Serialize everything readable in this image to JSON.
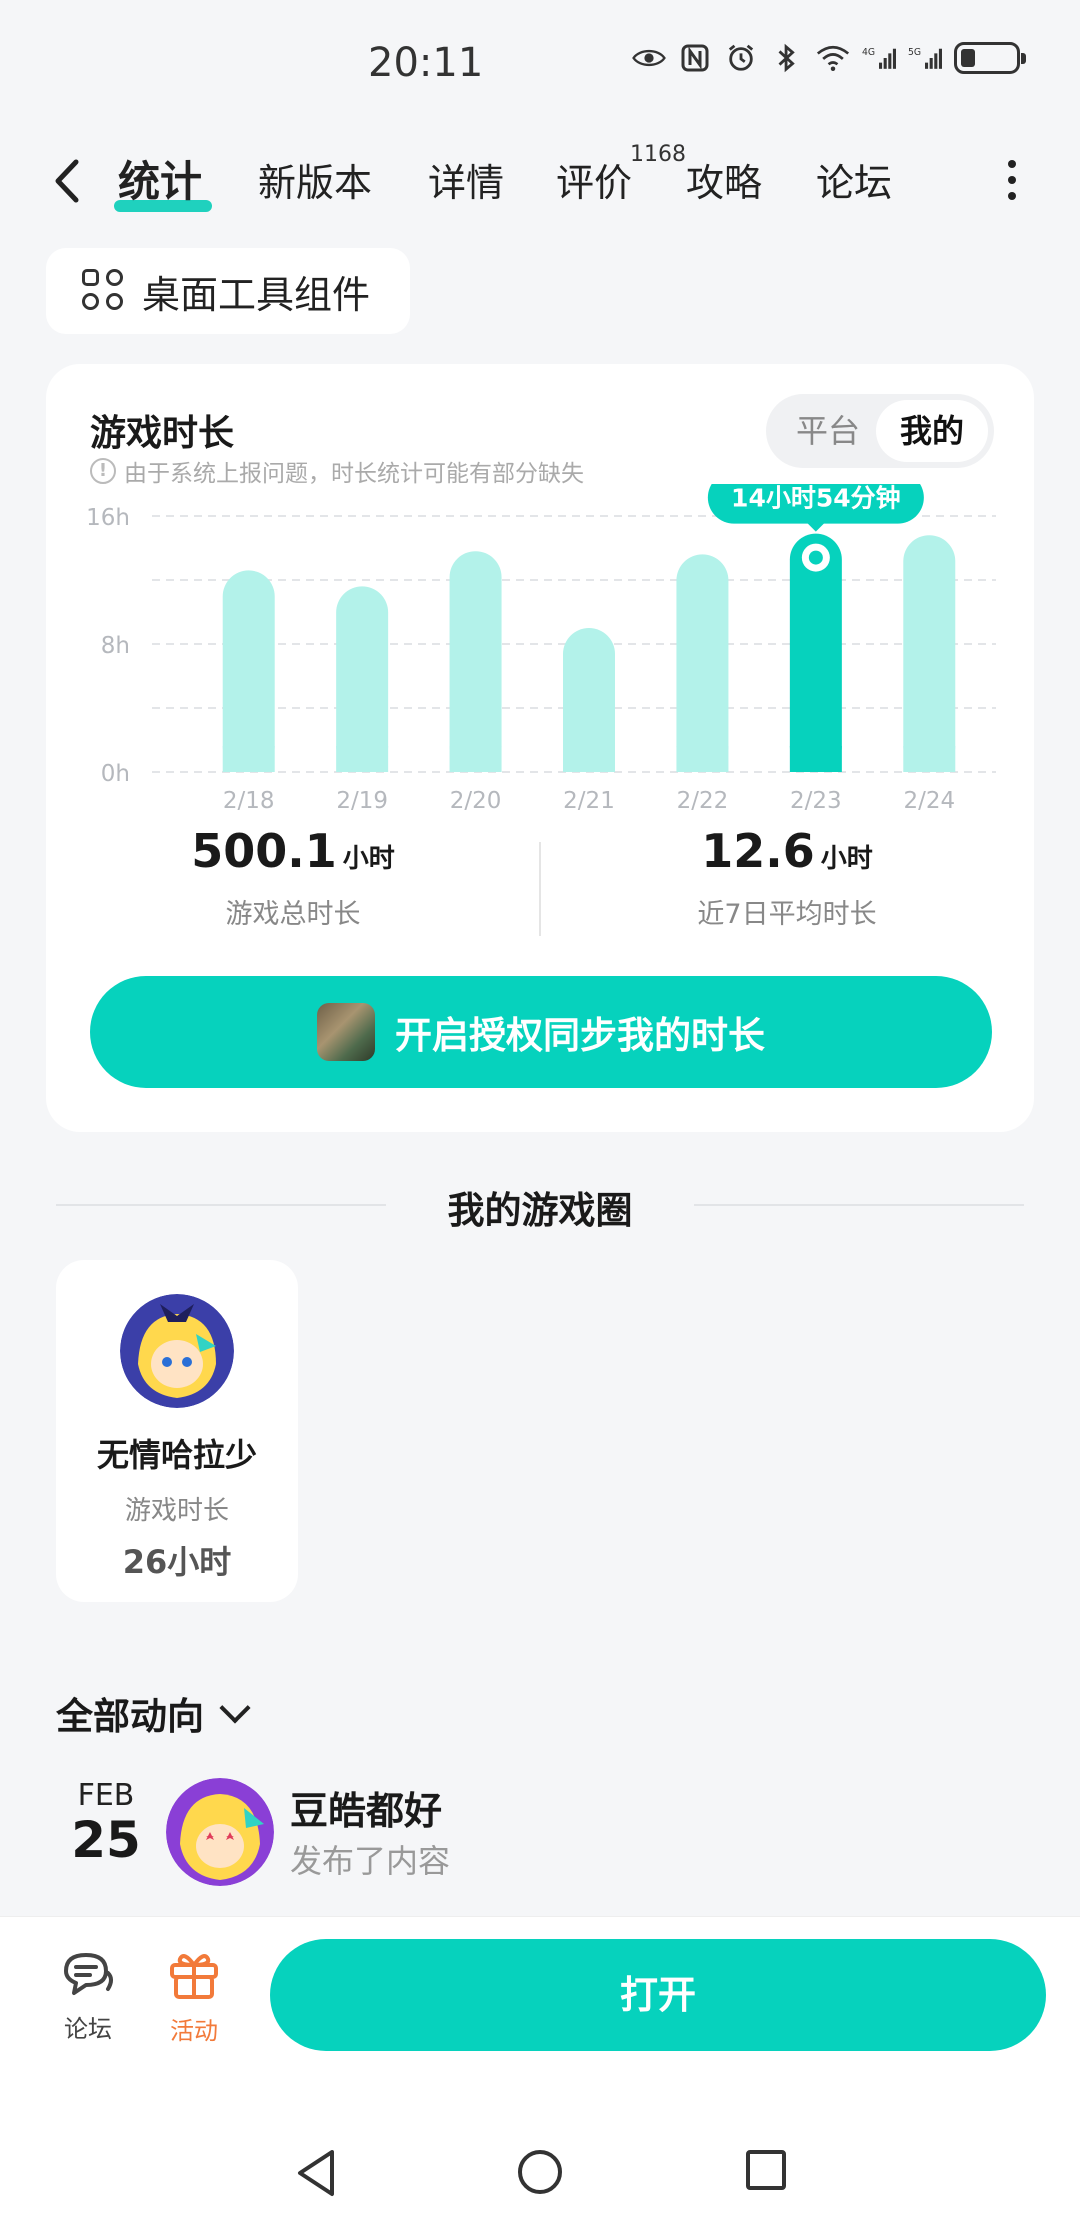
{
  "status_bar": {
    "time": "20:11"
  },
  "nav": {
    "tabs": [
      {
        "label": "统计",
        "active": true
      },
      {
        "label": "新版本"
      },
      {
        "label": "详情"
      },
      {
        "label": "评价",
        "badge": "1168"
      },
      {
        "label": "攻略"
      },
      {
        "label": "论坛"
      }
    ]
  },
  "widget_chip": {
    "label": "桌面工具组件"
  },
  "game_time": {
    "title": "游戏时长",
    "note": "由于系统上报问题，时长统计可能有部分缺失",
    "toggle": {
      "option_platform": "平台",
      "option_mine": "我的",
      "selected": "我的"
    },
    "tooltip": "14小时54分钟",
    "total": {
      "value": "500.1",
      "unit": "小时",
      "label": "游戏总时长"
    },
    "average": {
      "value": "12.6",
      "unit": "小时",
      "label": "近7日平均时长"
    },
    "sync_button": "开启授权同步我的时长"
  },
  "chart_data": {
    "type": "bar",
    "categories": [
      "2/18",
      "2/19",
      "2/20",
      "2/21",
      "2/22",
      "2/23",
      "2/24"
    ],
    "values": [
      12.6,
      11.6,
      13.8,
      9.0,
      13.6,
      14.9,
      14.8
    ],
    "y_ticks": [
      "0h",
      "8h",
      "16h"
    ],
    "ylim": [
      0,
      16
    ],
    "highlight_index": 5,
    "colors": {
      "bar": "#b3f2ea",
      "highlight": "#06d2bd"
    },
    "grid": true
  },
  "game_circle": {
    "title": "我的游戏圈",
    "friend": {
      "name": "无情哈拉少",
      "label": "游戏时长",
      "time": "26小时"
    }
  },
  "activity": {
    "filter_label": "全部动向",
    "item": {
      "month": "FEB",
      "day": "25",
      "user": "豆皓都好",
      "action": "发布了内容"
    }
  },
  "bottom_bar": {
    "forum_label": "论坛",
    "event_label": "活动",
    "open_button": "打开",
    "event_color": "#f27a3a"
  }
}
